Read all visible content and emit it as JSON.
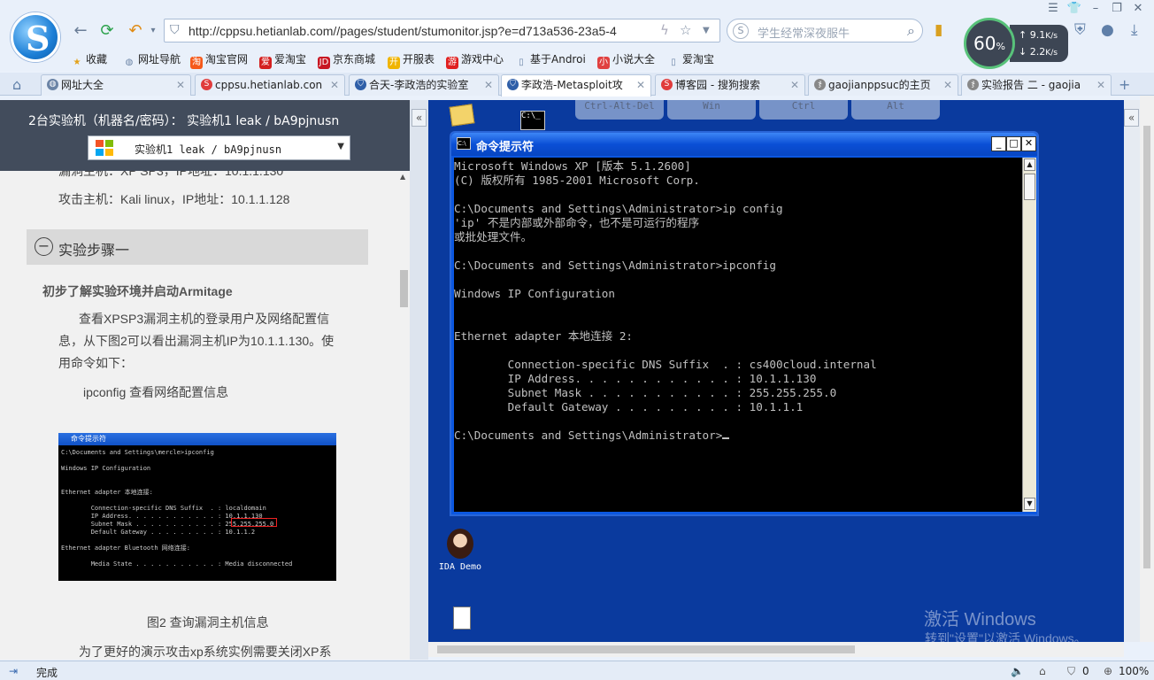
{
  "browser": {
    "url": "http://cppsu.hetianlab.com//pages/student/stumonitor.jsp?e=d713a536-23a5-4",
    "search_placeholder": "学生经常深夜服牛",
    "speed": {
      "percent": "60",
      "percent_unit": "%",
      "up": "9.1",
      "down": "2.2",
      "unit": "K/s"
    },
    "bookmarks": [
      "收藏",
      "网址导航",
      "淘宝官网",
      "爱淘宝",
      "京东商城",
      "开服表",
      "游戏中心",
      "基于Androi",
      "小说大全",
      "爱淘宝"
    ],
    "tabs": [
      {
        "label": "网址大全"
      },
      {
        "label": "cppsu.hetianlab.con"
      },
      {
        "label": "合天-李政浩的实验室"
      },
      {
        "label": "李政浩-Metasploit攻"
      },
      {
        "label": "博客园 - 搜狗搜索"
      },
      {
        "label": "gaojianppsuc的主页"
      },
      {
        "label": "实验报告 二 - gaojia"
      }
    ],
    "status": "完成",
    "status_count": "0",
    "zoom": "100%"
  },
  "panel": {
    "title": "2台实验机（机器名/密码）：  实验机1    leak / bA9pjnusn",
    "selected_machine": "实验机1     leak  /  bA9pjnusn",
    "hidden_line": "漏洞主机：XP SP3，IP地址：10.1.1.130",
    "attacker_line": "攻击主机：Kali linux，IP地址：10.1.1.128",
    "step_title": "实验步骤一",
    "subtitle": "初步了解实验环境并启动Armitage",
    "para1_line1": "查看XPSP3漏洞主机的登录用户及网络配置信",
    "para1_line2": "息，从下图2可以看出漏洞主机IP为10.1.1.130。使",
    "para1_line3": "用命令如下：",
    "command_note": "ipconfig 查看网络配置信息",
    "figure_caption": "图2 查询漏洞主机信息",
    "bottom_line": "为了更好的演示攻击xp系统实例需要关闭XP系",
    "thumb_title": "命令提示符",
    "thumb_text": "C:\\Documents and Settings\\mercle>ipconfig\n\nWindows IP Configuration\n\n\nEthernet adapter 本地连接:\n\n        Connection-specific DNS Suffix  . : localdomain\n        IP Address. . . . . . . . . . . . : 10.1.1.130\n        Subnet Mask . . . . . . . . . . . : 255.255.255.0\n        Default Gateway . . . . . . . . . : 10.1.1.2\n\nEthernet adapter Bluetooth 网络连接:\n\n        Media State . . . . . . . . . . . : Media disconnected"
  },
  "remote": {
    "keys": [
      "Ctrl-Alt-Del",
      "Win",
      "Ctrl",
      "Alt"
    ],
    "cmd_title": "命令提示符",
    "cmd_text": "Microsoft Windows XP [版本 5.1.2600]\n(C) 版权所有 1985-2001 Microsoft Corp.\n\nC:\\Documents and Settings\\Administrator>ip config\n'ip' 不是内部或外部命令，也不是可运行的程序\n或批处理文件。\n\nC:\\Documents and Settings\\Administrator>ipconfig\n\nWindows IP Configuration\n\n\nEthernet adapter 本地连接 2:\n\n        Connection-specific DNS Suffix  . : cs400cloud.internal\n        IP Address. . . . . . . . . . . . : 10.1.1.130\n        Subnet Mask . . . . . . . . . . . : 255.255.255.0\n        Default Gateway . . . . . . . . . : 10.1.1.1\n\nC:\\Documents and Settings\\Administrator>",
    "desktop_icons": [
      "IDA Demo"
    ],
    "watermark_title": "激活 Windows",
    "watermark_sub": "转到\"设置\"以激活 Windows。"
  }
}
